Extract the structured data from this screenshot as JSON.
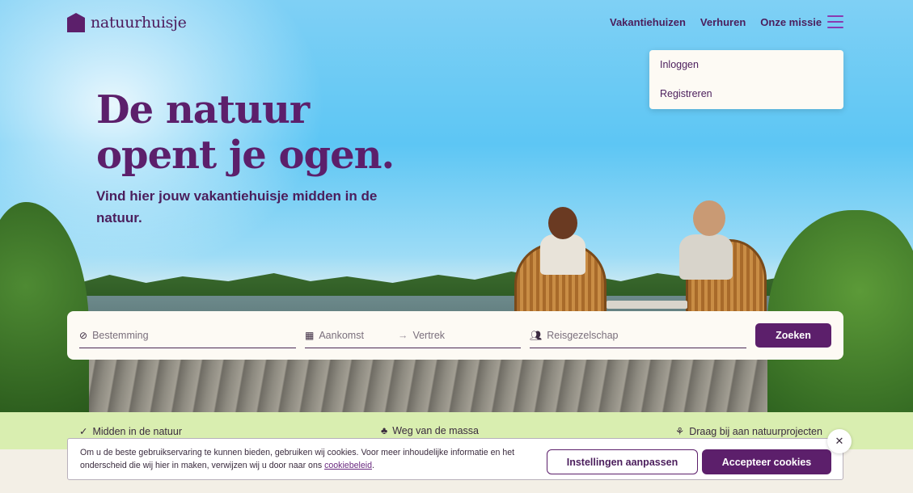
{
  "brand": {
    "name": "natuurhuisje",
    "icon": "house-logo-icon"
  },
  "nav": {
    "items": [
      "Vakantiehuizen",
      "Verhuren",
      "Onze missie"
    ],
    "menu_icon": "hamburger-menu-icon"
  },
  "account_menu": {
    "login": "Inloggen",
    "register": "Registreren"
  },
  "hero": {
    "headline_line1": "De natuur",
    "headline_line2": "opent je ogen.",
    "subline": "Vind hier jouw vakantiehuisje midden in de natuur."
  },
  "search": {
    "destination_placeholder": "Bestemming",
    "arrival_placeholder": "Aankomst",
    "departure_placeholder": "Vertrek",
    "guests_placeholder": "Reisgezelschap",
    "button": "Zoeken"
  },
  "usps": [
    "Midden in de natuur",
    "Weg van de massa",
    "Draag bij aan natuurprojecten"
  ],
  "cookie": {
    "text": "Om u de beste gebruikservaring te kunnen bieden, gebruiken wij cookies. Voor meer inhoudelijke informatie en het onderscheid die wij hier in maken, verwijzen wij u door naar ons ",
    "link": "cookiebeleid",
    "suffix": ".",
    "settings_button": "Instellingen aanpassen",
    "accept_button": "Accepteer cookies"
  },
  "colors": {
    "brand_purple": "#5c1f6b",
    "usp_green": "#d9eeb0",
    "card_bg": "#fdfaf4"
  }
}
